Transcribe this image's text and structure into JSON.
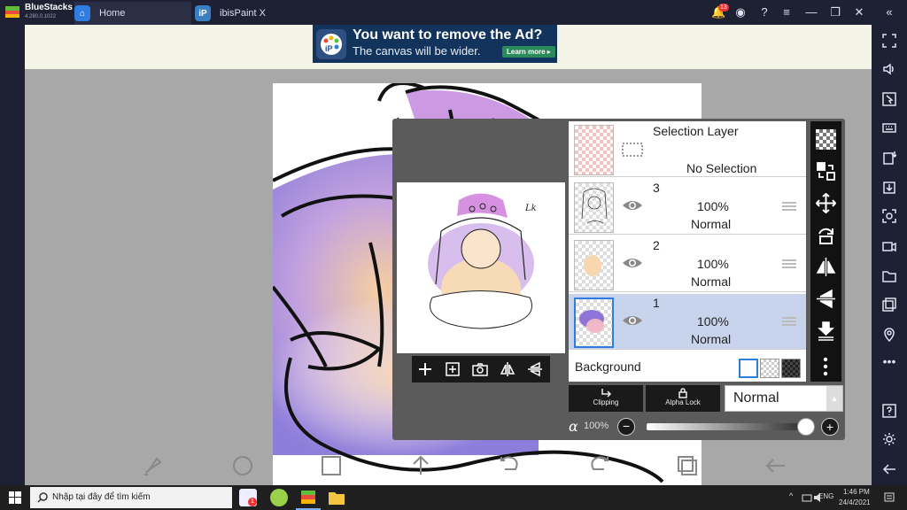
{
  "titlebar": {
    "brand": "BlueStacks",
    "version": "4.280.0.1022",
    "tabs": [
      {
        "label": "Home"
      },
      {
        "label": "ibisPaint X"
      }
    ],
    "notification_count": "13"
  },
  "ad": {
    "headline": "You want to remove the Ad?",
    "subtext": "The canvas will be wider.",
    "cta": "Learn more ▸"
  },
  "layers_panel": {
    "selection_layer": {
      "title": "Selection Layer",
      "status": "No Selection"
    },
    "layers": [
      {
        "number": "3",
        "opacity": "100%",
        "blend": "Normal",
        "selected": false
      },
      {
        "number": "2",
        "opacity": "100%",
        "blend": "Normal",
        "selected": false
      },
      {
        "number": "1",
        "opacity": "100%",
        "blend": "Normal",
        "selected": true
      }
    ],
    "background_label": "Background",
    "clipping_label": "Clipping",
    "alpha_lock_label": "Alpha Lock",
    "blend_mode": "Normal",
    "alpha_symbol": "α",
    "alpha_value": "100%",
    "alpha_fraction": 1.0
  },
  "taskbar": {
    "search_placeholder": "Nhập tại đây để tìm kiếm",
    "language": "ENG",
    "time": "1:46 PM",
    "date": "24/4/2021",
    "badge": "1"
  },
  "colors": {
    "accent_blue": "#2f7de0",
    "panel_gray": "#5b5b5b",
    "toolbar_black": "#121212",
    "selected_row": "#c8d4ec"
  }
}
